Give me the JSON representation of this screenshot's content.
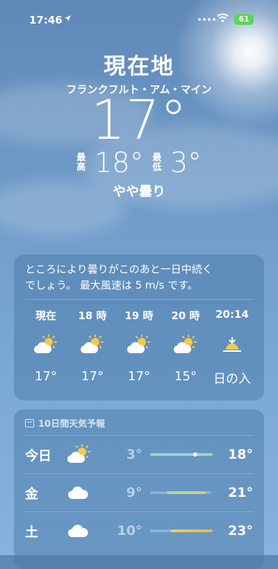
{
  "status_bar": {
    "time": "17:46",
    "battery": "61"
  },
  "header": {
    "location": "現在地",
    "city": "フランクフルト・アム・マイン",
    "temperature": "17°",
    "high_label": "最高",
    "high": "18°",
    "low_label": "最低",
    "low": "3°",
    "condition": "やや曇り"
  },
  "hourly": {
    "summary_line1": "ところにより曇りがこのあと一日中続く",
    "summary_line2": "でしょう。 最大風速は 5 m/s です。",
    "hours": [
      {
        "label": "現在",
        "icon": "partly-cloudy-sun-icon",
        "temp": "17°"
      },
      {
        "label": "18 時",
        "icon": "partly-cloudy-sun-icon",
        "temp": "17°"
      },
      {
        "label": "19 時",
        "icon": "partly-cloudy-sun-icon",
        "temp": "17°"
      },
      {
        "label": "20 時",
        "icon": "partly-cloudy-sun-icon",
        "temp": "15°"
      },
      {
        "label": "20:14",
        "icon": "sunset-icon",
        "temp": "日の入"
      }
    ]
  },
  "ten_day": {
    "title": "10日間天気予報",
    "days": [
      {
        "day": "今日",
        "icon": "partly-cloudy-sun-icon",
        "low": "3°",
        "high": "18°",
        "range_color": "#9fd3c7",
        "current_marker": true
      },
      {
        "day": "金",
        "icon": "cloud-icon",
        "low": "9°",
        "high": "21°",
        "range_color": "#c8d98c",
        "current_marker": false
      },
      {
        "day": "土",
        "icon": "cloud-icon",
        "low": "10°",
        "high": "23°",
        "range_color": "#f0c84a",
        "current_marker": false
      }
    ]
  }
}
